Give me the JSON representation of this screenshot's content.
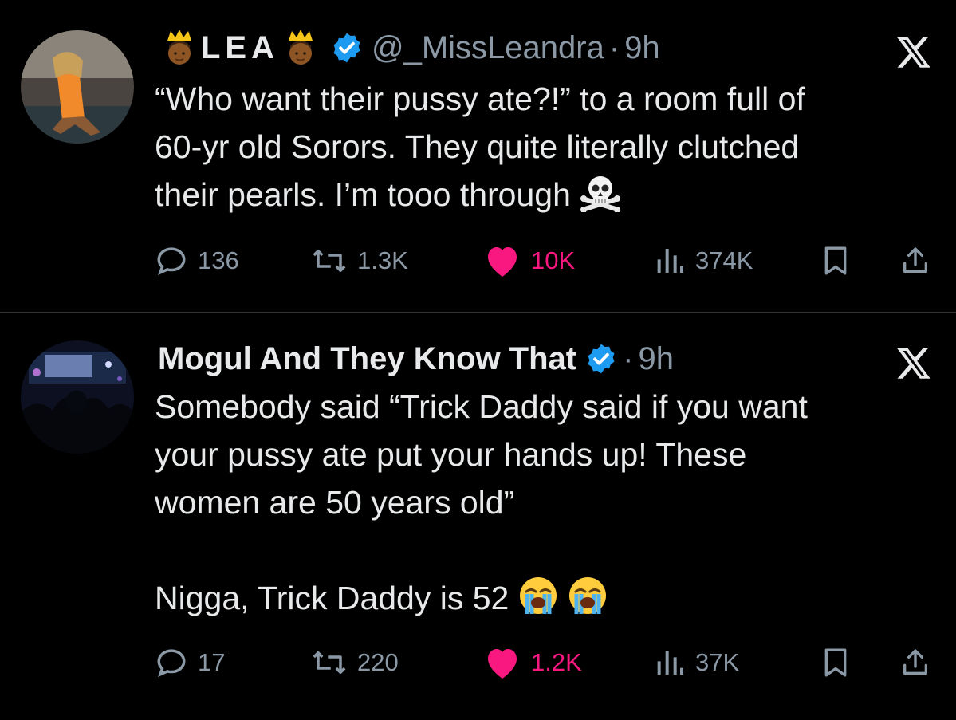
{
  "tweets": [
    {
      "display_name": "LEA",
      "name_emoji": "crown-emoji",
      "verified": true,
      "handle": "@_MissLeandra",
      "separator": "·",
      "time": "9h",
      "body": [
        "“Who want their pussy ate?!” to a room full of",
        "60-yr old Sorors. They quite literally clutched",
        "their pearls. I’m tooo through"
      ],
      "trailing_emoji": [
        "skull-crossbones-emoji"
      ],
      "stats": {
        "replies": "136",
        "reposts": "1.3K",
        "likes": "10K",
        "views": "374K"
      },
      "liked": true
    },
    {
      "display_name": "Mogul And They Know That",
      "verified": true,
      "separator": "·",
      "time": "9h",
      "body": [
        "Somebody said “Trick Daddy said if you want",
        "your pussy ate put your hands up! These",
        "women are 50 years old”"
      ],
      "body2": "Nigga, Trick Daddy is 52",
      "trailing_emoji": [
        "loudly-crying-face-emoji",
        "loudly-crying-face-emoji"
      ],
      "stats": {
        "replies": "17",
        "reposts": "220",
        "likes": "1.2K",
        "views": "37K"
      },
      "liked": true
    }
  ],
  "colors": {
    "background": "#000000",
    "text": "#e7e9ea",
    "muted": "#8b98a5",
    "like": "#f91880",
    "verified": "#1d9bf0"
  }
}
